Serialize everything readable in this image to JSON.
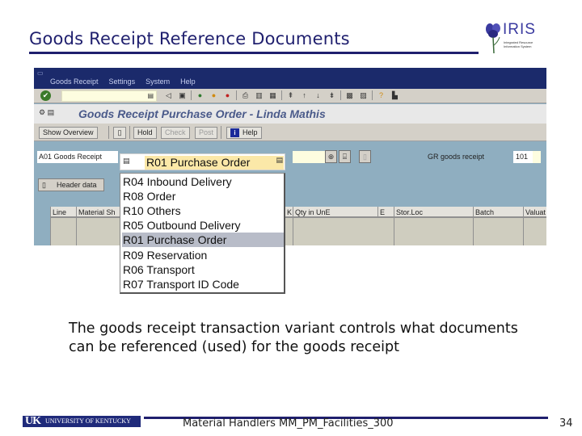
{
  "slide": {
    "title": "Goods Receipt Reference Documents",
    "logo": {
      "name": "IRIS",
      "subtitle_line1": "Integrated Resource",
      "subtitle_line2": "Information System"
    },
    "body": "The goods receipt transaction variant controls what documents can be referenced (used) for the goods receipt",
    "footer": {
      "university": "UNIVERSITY OF KENTUCKY",
      "university_mark": "UK",
      "course": "Material Handlers MM_PM_Facilities_300",
      "page": "34"
    }
  },
  "sap": {
    "menu": [
      "Goods Receipt",
      "Settings",
      "System",
      "Help"
    ],
    "command_field": {
      "value": ""
    },
    "screen_title": "Goods Receipt Purchase Order - Linda Mathis",
    "app_buttons": [
      {
        "label": "Show Overview",
        "enabled": true
      },
      {
        "label": "Hold",
        "enabled": true
      },
      {
        "label": "Check",
        "enabled": false
      },
      {
        "label": "Post",
        "enabled": false
      },
      {
        "label": "Help",
        "enabled": true
      }
    ],
    "transaction_field": "A01 Goods Receipt",
    "reference_document": {
      "selected": "R01 Purchase Order",
      "options": [
        "R04 Inbound Delivery",
        "R08 Order",
        "R10 Others",
        "R05 Outbound Delivery",
        "R01 Purchase Order",
        "R09 Reservation",
        "R06 Transport",
        "R07 Transport ID Code"
      ],
      "highlighted": "R01 Purchase Order"
    },
    "movement_type": {
      "label": "GR goods receipt",
      "value": "101"
    },
    "header_button": "Header data",
    "table_columns": [
      "Line",
      "Material Sh",
      "K",
      "Qty in UnE",
      "E",
      "Stor.Loc",
      "Batch",
      "Valuat"
    ]
  }
}
